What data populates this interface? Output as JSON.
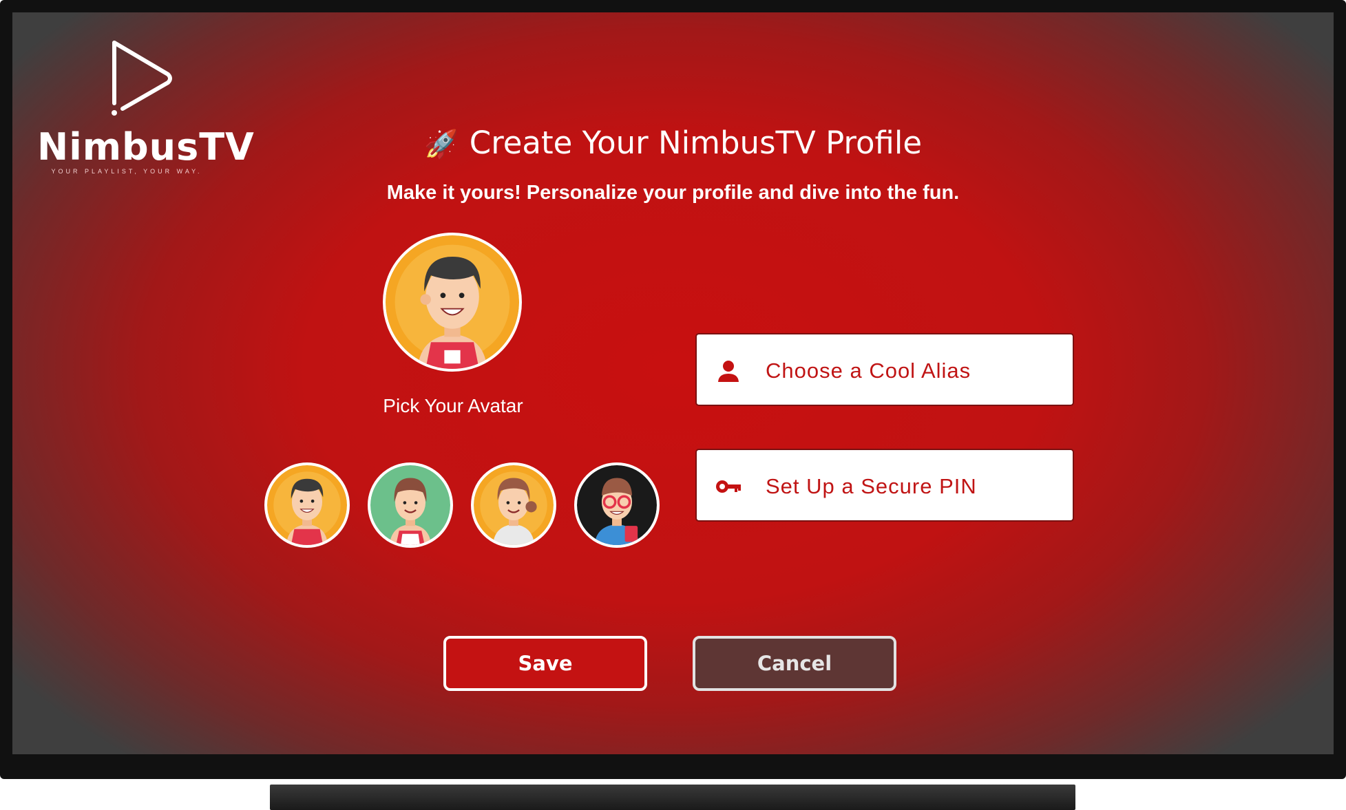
{
  "brand": {
    "name": "NimbusTV",
    "tagline": "YOUR PLAYLIST, YOUR WAY."
  },
  "header": {
    "icon": "rocket-icon",
    "title": "Create Your NimbusTV Profile",
    "subtitle": "Make it yours! Personalize your profile and dive into the fun."
  },
  "avatar": {
    "label": "Pick Your Avatar",
    "options": [
      {
        "name": "boy-avatar",
        "bg": "#f5a623"
      },
      {
        "name": "girl-green-avatar",
        "bg": "#6cc08b"
      },
      {
        "name": "girl-orange-avatar",
        "bg": "#f5a623"
      },
      {
        "name": "glasses-man-avatar",
        "bg": "#1a1a1a"
      }
    ]
  },
  "form": {
    "alias_label": "Choose a Cool Alias",
    "alias_icon": "user-icon",
    "pin_label": "Set Up a Secure PIN",
    "pin_icon": "key-icon"
  },
  "actions": {
    "save_label": "Save",
    "cancel_label": "Cancel"
  },
  "colors": {
    "accent": "#c41212",
    "cancel_bg": "#5e3634"
  }
}
